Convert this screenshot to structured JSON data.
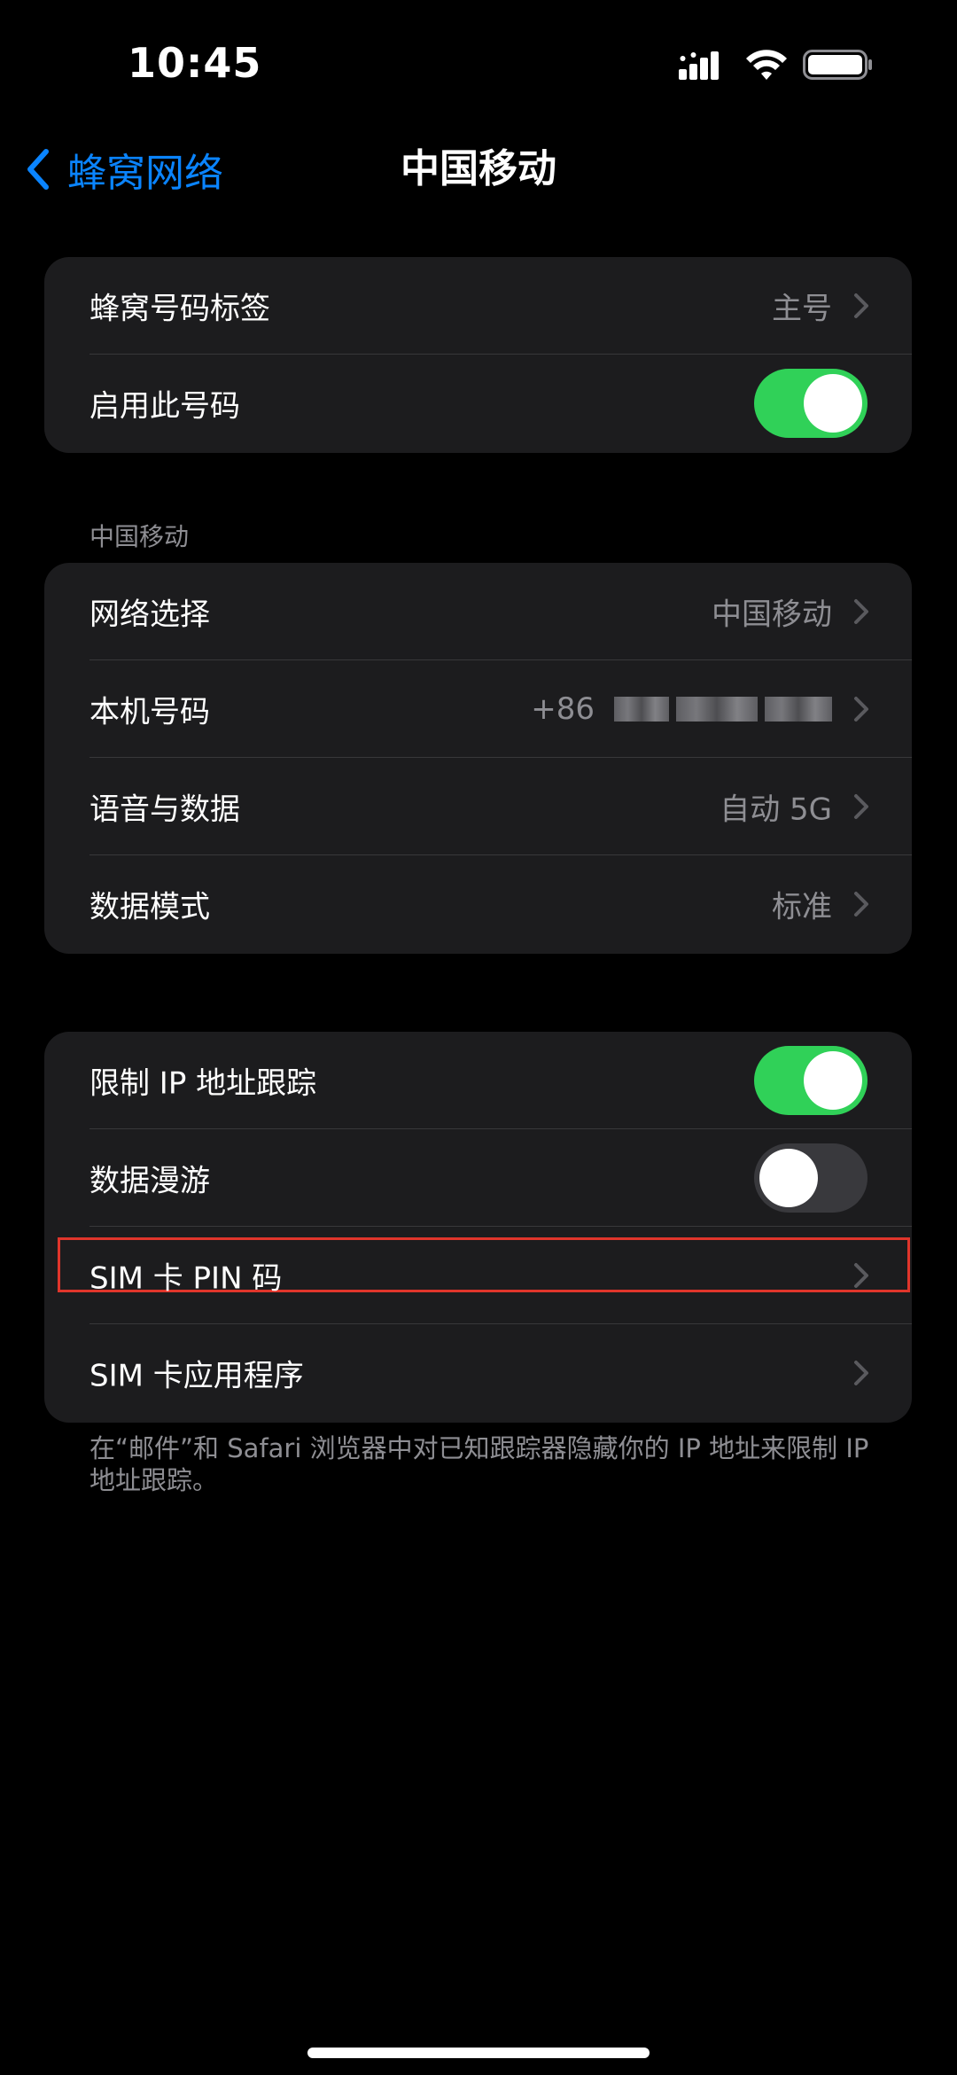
{
  "status_bar": {
    "time": "10:45"
  },
  "nav": {
    "back_label": "蜂窝网络",
    "title": "中国移动"
  },
  "group1": {
    "rows": [
      {
        "label": "蜂窝号码标签",
        "value": "主号"
      },
      {
        "label": "启用此号码",
        "toggle": "on"
      }
    ]
  },
  "section_header": "中国移动",
  "group2": {
    "rows": [
      {
        "label": "网络选择",
        "value": "中国移动"
      },
      {
        "label": "本机号码",
        "value_prefix": "+86"
      },
      {
        "label": "语音与数据",
        "value": "自动 5G"
      },
      {
        "label": "数据模式",
        "value": "标准"
      }
    ]
  },
  "group3": {
    "rows": [
      {
        "label": "限制 IP 地址跟踪",
        "toggle": "on"
      },
      {
        "label": "数据漫游",
        "toggle": "off"
      },
      {
        "label": "SIM 卡 PIN 码"
      },
      {
        "label": "SIM 卡应用程序"
      }
    ]
  },
  "footer_note": "在“邮件”和 Safari 浏览器中对已知跟踪器隐藏你的 IP 地址来限制 IP 地址跟踪。",
  "colors": {
    "accent": "#0a84ff",
    "toggle_on": "#30d158",
    "group_bg": "#1c1c1e",
    "secondary_text": "#8e8e93",
    "highlight": "#e0352b"
  },
  "icons": [
    "signal-icon",
    "wifi-icon",
    "battery-icon",
    "back-chevron-icon",
    "chevron-right-icon"
  ]
}
